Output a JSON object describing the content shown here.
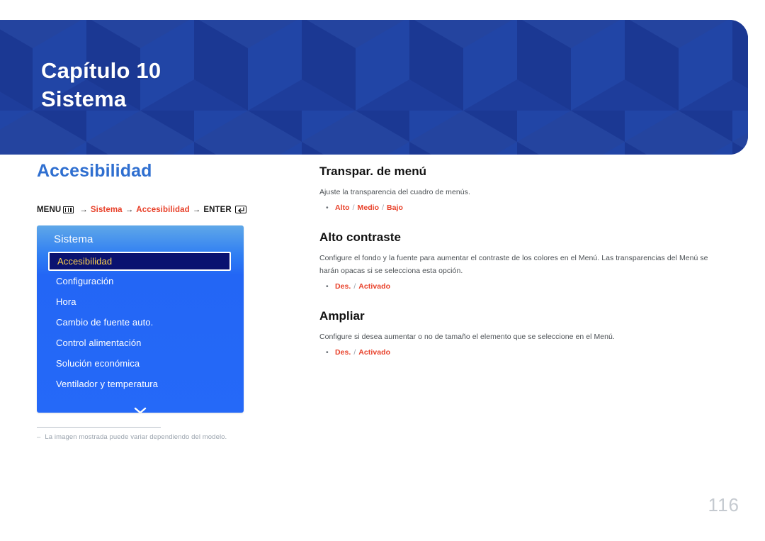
{
  "banner": {
    "chapter": "Capítulo 10",
    "title": "Sistema",
    "bg_color": "#1e3d9b"
  },
  "left": {
    "section_title": "Accesibilidad",
    "menu_path": {
      "prefix": "MENU",
      "menu_icon": "menu-grid-icon",
      "arrow": "→",
      "step1": "Sistema",
      "step2": "Accesibilidad",
      "enter_label": "ENTER",
      "enter_icon": "enter-return-icon",
      "highlight_color": "#e8412a"
    },
    "osd": {
      "title": "Sistema",
      "items": [
        {
          "label": "Accesibilidad",
          "selected": true
        },
        {
          "label": "Configuración",
          "selected": false
        },
        {
          "label": "Hora",
          "selected": false
        },
        {
          "label": "Cambio de fuente auto.",
          "selected": false
        },
        {
          "label": "Control alimentación",
          "selected": false
        },
        {
          "label": "Solución económica",
          "selected": false
        },
        {
          "label": "Ventilador y temperatura",
          "selected": false
        }
      ],
      "more_icon": "chevron-down-icon",
      "selected_text_color": "#ffd24d",
      "selected_bg_color": "#0a1270"
    },
    "footnote": {
      "dash": "‒",
      "text": "La imagen mostrada puede variar dependiendo del modelo."
    }
  },
  "right": {
    "blocks": [
      {
        "title": "Transpar. de menú",
        "description": "Ajuste la transparencia del cuadro de menús.",
        "options": [
          {
            "bullet": "•",
            "parts": [
              "Alto",
              " / ",
              "Medio",
              " / ",
              "Bajo"
            ]
          }
        ]
      },
      {
        "title": "Alto contraste",
        "description": "Configure el fondo y la fuente para aumentar el contraste de los colores en el Menú. Las transparencias del Menú se harán opacas si se selecciona esta opción.",
        "options": [
          {
            "bullet": "•",
            "parts": [
              "Des.",
              " / ",
              "Activado"
            ]
          }
        ]
      },
      {
        "title": "Ampliar",
        "description": "Configure si desea aumentar o no de tamaño el elemento que se seleccione en el Menú.",
        "options": [
          {
            "bullet": "•",
            "parts": [
              "Des.",
              " / ",
              "Activado"
            ]
          }
        ]
      }
    ]
  },
  "page_number": "116"
}
